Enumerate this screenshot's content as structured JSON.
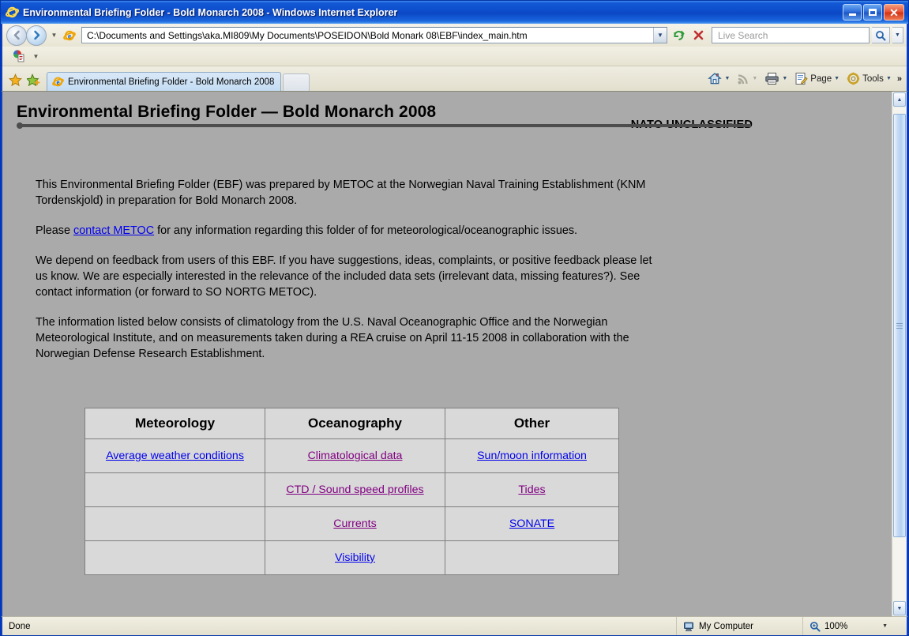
{
  "window": {
    "title": "Environmental Briefing Folder - Bold Monarch 2008 - Windows Internet Explorer",
    "minimize_label": "Minimize",
    "maximize_label": "Maximize",
    "close_label": "Close"
  },
  "navigation": {
    "back_label": "Back",
    "forward_label": "Forward",
    "recent_pages_label": "Recent Pages",
    "address_value": "C:\\Documents and Settings\\aka.MI809\\My Documents\\POSEIDON\\Bold Monark 08\\EBF\\index_main.htm",
    "address_dropdown_label": "Address history",
    "refresh_label": "Refresh",
    "stop_label": "Stop"
  },
  "search": {
    "placeholder": "Live Search",
    "value": "",
    "go_label": "Search",
    "provider_dropdown_label": "Search provider options"
  },
  "toolbar": {
    "favorites_label": "Favorites Center",
    "add_favorites_label": "Add to Favorites",
    "home_label": "Home",
    "feeds_label": "Feeds",
    "print_label": "Print",
    "page_label": "Page",
    "tools_label": "Tools",
    "overflow_label": "More"
  },
  "tabs": {
    "items": [
      {
        "label": "Environmental Briefing Folder - Bold Monarch 2008",
        "active": true
      }
    ],
    "new_tab_label": "New Tab"
  },
  "page": {
    "title": "Environmental Briefing Folder — Bold Monarch 2008",
    "classification": "NATO UNCLASSIFIED",
    "paragraphs": {
      "p1": "This Environmental Briefing Folder (EBF) was prepared by METOC at the Norwegian Naval Training Establishment (KNM Tordenskjold) in preparation for Bold Monarch 2008.",
      "p2_before": "Please ",
      "p2_link": "contact METOC",
      "p2_after": " for any information regarding this folder of for meteorological/oceanographic issues.",
      "p3": "We depend on feedback from users of this EBF. If you have suggestions, ideas, complaints, or positive feedback please let us know. We are especially interested in the relevance of the included data sets (irrelevant data, missing features?). See contact information (or forward to SO NORTG METOC).",
      "p4": "The information listed below consists of climatology from the U.S. Naval Oceanographic Office and the Norwegian Meteorological Institute, and on measurements taken during a REA cruise on April 11-15 2008 in collaboration with the Norwegian Defense Research Establishment."
    },
    "table": {
      "headers": [
        "Meteorology",
        "Oceanography",
        "Other"
      ],
      "rows": [
        [
          {
            "label": "Average weather conditions",
            "visited": false
          },
          {
            "label": "Climatological data",
            "visited": true
          },
          {
            "label": "Sun/moon information",
            "visited": false
          }
        ],
        [
          {
            "label": "",
            "visited": false
          },
          {
            "label": "CTD / Sound speed profiles",
            "visited": true
          },
          {
            "label": "Tides",
            "visited": true
          }
        ],
        [
          {
            "label": "",
            "visited": false
          },
          {
            "label": "Currents",
            "visited": true
          },
          {
            "label": "SONATE",
            "visited": false
          }
        ],
        [
          {
            "label": "",
            "visited": false
          },
          {
            "label": "Visibility",
            "visited": false
          },
          {
            "label": "",
            "visited": false
          }
        ]
      ]
    }
  },
  "statusbar": {
    "status": "Done",
    "zone": "My Computer",
    "zoom": "100%"
  },
  "colors": {
    "link": "#0000ee",
    "visited_link": "#800080",
    "page_background": "#aaaaaa",
    "title_bar": "#0a46c4"
  }
}
